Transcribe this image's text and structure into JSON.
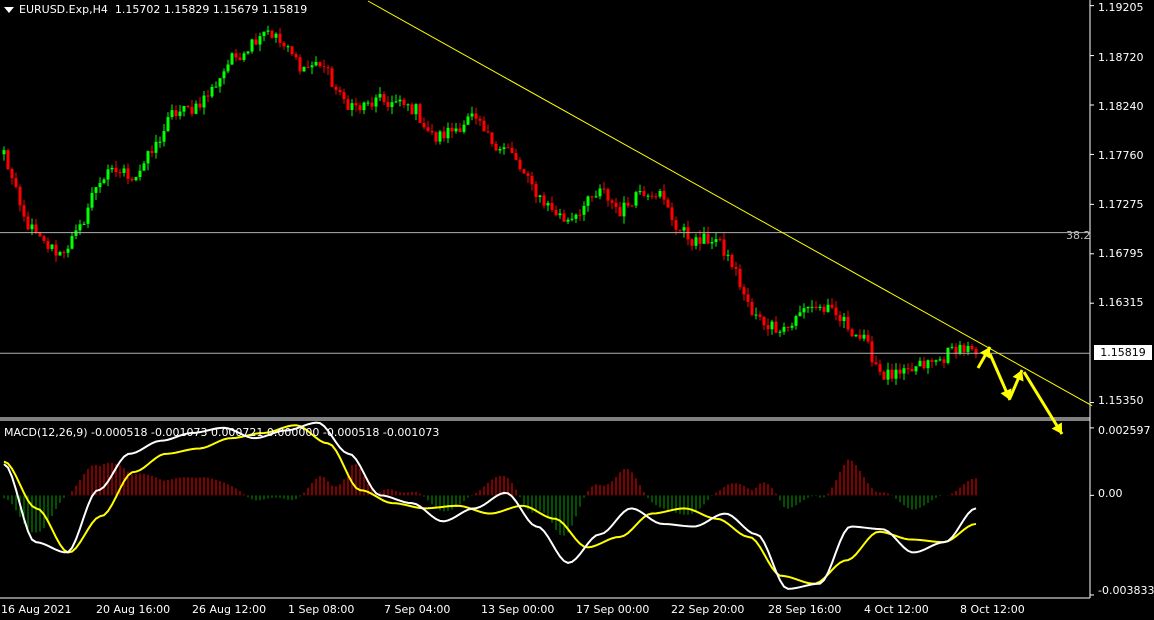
{
  "window": {
    "symbol": "EURUSD.Exp,H4",
    "ohlc": "1.15702 1.15829 1.15679 1.15819"
  },
  "colors": {
    "background": "#000000",
    "bull_candle": "#00ff00",
    "bear_candle": "#ff0000",
    "trendline": "#ffff00",
    "macd_main": "#ffffff",
    "macd_signal": "#ffff00",
    "hist_positive": "#ff0000",
    "hist_negative": "#00a000"
  },
  "price_axis": {
    "ticks": [
      "1.19205",
      "1.18720",
      "1.18240",
      "1.17760",
      "1.17275",
      "1.16795",
      "1.16315",
      "1.15350"
    ],
    "current_price": "1.15819",
    "range": [
      1.152,
      1.1925
    ]
  },
  "fibonacci": {
    "level_label": "38.2",
    "level_price": 1.17
  },
  "horizontal_line_price": 1.15829,
  "macd": {
    "header": "MACD(12,26,9) -0.000518 -0.001073 0.000721 0.000000 -0.000518 -0.001073",
    "ticks": [
      "0.002597",
      "0.00",
      "-0.003833"
    ],
    "range": [
      -0.00395,
      0.0029
    ]
  },
  "time_axis": {
    "labels": [
      "16 Aug 2021",
      "20 Aug 16:00",
      "26 Aug 12:00",
      "1 Sep 08:00",
      "7 Sep 04:00",
      "13 Sep 00:00",
      "17 Sep 00:00",
      "22 Sep 20:00",
      "28 Sep 16:00",
      "4 Oct 12:00",
      "8 Oct 12:00"
    ]
  },
  "chart_data": {
    "type": "candlestick",
    "instrument": "EURUSD.Exp",
    "timeframe": "H4",
    "close_path": [
      1.1778,
      1.1715,
      1.169,
      1.168,
      1.17,
      1.175,
      1.176,
      1.1755,
      1.178,
      1.1815,
      1.182,
      1.1835,
      1.1865,
      1.188,
      1.19,
      1.188,
      1.186,
      1.1865,
      1.183,
      1.182,
      1.1828,
      1.1825,
      1.182,
      1.179,
      1.18,
      1.1812,
      1.179,
      1.178,
      1.175,
      1.1728,
      1.1712,
      1.1725,
      1.174,
      1.172,
      1.1742,
      1.174,
      1.1705,
      1.169,
      1.1695,
      1.1668,
      1.162,
      1.161,
      1.1608,
      1.163,
      1.1625,
      1.1612,
      1.1595,
      1.1562,
      1.156,
      1.157,
      1.1575,
      1.159,
      1.1582
    ],
    "macd_main_path": [
      0.0012,
      -0.0018,
      -0.0022,
      0.0002,
      0.0016,
      0.0021,
      0.0024,
      0.0026,
      0.0022,
      0.0025,
      0.0028,
      0.0016,
      0.0,
      -0.0003,
      -0.001,
      -0.0005,
      0.0001,
      -0.0012,
      -0.0026,
      -0.0015,
      -0.0005,
      -0.0011,
      -0.0012,
      -0.0007,
      -0.0015,
      -0.0036,
      -0.0034,
      -0.0012,
      -0.0013,
      -0.0022,
      -0.0018,
      -0.0005
    ],
    "macd_signal_path": [
      0.0013,
      -0.0005,
      -0.0022,
      -0.0008,
      0.0009,
      0.0016,
      0.0018,
      0.0022,
      0.0024,
      0.0027,
      0.002,
      0.0002,
      -0.0003,
      -0.0005,
      -0.0004,
      -0.0007,
      -0.0004,
      -0.0009,
      -0.002,
      -0.0016,
      -0.0007,
      -0.0005,
      -0.0009,
      -0.0016,
      -0.0031,
      -0.0034,
      -0.0025,
      -0.0014,
      -0.0017,
      -0.0018,
      -0.0011
    ]
  }
}
